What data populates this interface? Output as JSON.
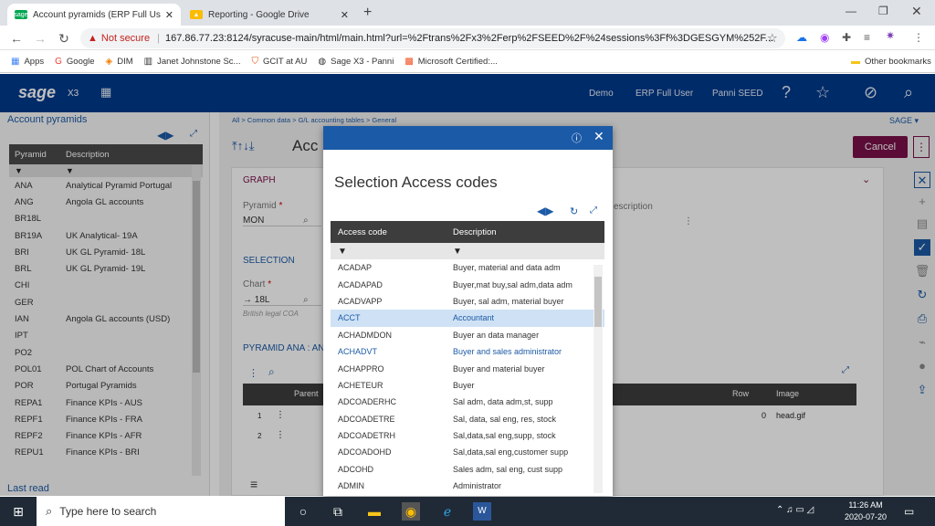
{
  "browser": {
    "tabs": [
      {
        "label": "Account pyramids (ERP Full User",
        "favicon": "sage"
      },
      {
        "label": "Reporting - Google Drive",
        "favicon": "drive"
      }
    ],
    "security": "Not secure",
    "url": "167.86.77.23:8124/syracuse-main/html/main.html?url=%2Ftrans%2Fx3%2Ferp%2FSEED%2F%24sessions%3Ff%3DGESGYM%252F...",
    "bookmarks": [
      "Apps",
      "Google",
      "DIM",
      "Janet Johnstone Sc...",
      "GCIT at AU",
      "Sage X3 - Panni",
      "Microsoft Certified:..."
    ],
    "other_bookmarks": "Other bookmarks"
  },
  "sage": {
    "logo": "sage",
    "product": "X3",
    "links": [
      "Demo",
      "ERP Full User",
      "Panni SEED"
    ]
  },
  "left": {
    "title": "Account pyramids",
    "columns": [
      "Pyramid",
      "Description"
    ],
    "filter": "T",
    "rows": [
      [
        "ANA",
        "Analytical Pyramid Portugal"
      ],
      [
        "ANG",
        "Angola GL accounts"
      ],
      [
        "BR18L",
        ""
      ],
      [
        "BR19A",
        "UK Analytical- 19A"
      ],
      [
        "BRI",
        "UK GL Pyramid- 18L"
      ],
      [
        "BRL",
        "UK GL Pyramid- 19L"
      ],
      [
        "CHI",
        ""
      ],
      [
        "GER",
        ""
      ],
      [
        "IAN",
        "Angola GL accounts (USD)"
      ],
      [
        "IPT",
        ""
      ],
      [
        "PO2",
        ""
      ],
      [
        "POL01",
        "POL Chart of Accounts"
      ],
      [
        "POR",
        "Portugal Pyramids"
      ],
      [
        "REPA1",
        "Finance KPIs - AUS"
      ],
      [
        "REPF1",
        "Finance KPIs - FRA"
      ],
      [
        "REPF2",
        "Finance KPIs - AFR"
      ],
      [
        "REPU1",
        "Finance KPIs - BRI"
      ]
    ],
    "footer": "Last read"
  },
  "main": {
    "breadcrumb": [
      "All",
      "Common data",
      "G/L accounting tables",
      "General"
    ],
    "site": "SAGE",
    "title": "Acc",
    "cancel": "Cancel",
    "section_graph": "GRAPH",
    "pyramid_label": "Pyramid",
    "pyramid_value": "MON",
    "description_label": "escription",
    "section_selection": "SELECTION",
    "chart_label": "Chart",
    "chart_value": "→ 18L",
    "chart_desc": "British legal COA",
    "section_pyramid": "PYRAMID ANA : AN",
    "grid_cols": [
      "Parent",
      "Row",
      "Image"
    ],
    "grid_rows": [
      {
        "num": "1",
        "row": "0",
        "image": "head.gif"
      },
      {
        "num": "2",
        "row": "",
        "image": ""
      }
    ]
  },
  "modal": {
    "title": "Selection Access codes",
    "columns": [
      "Access code",
      "Description"
    ],
    "rows": [
      [
        "ACADAP",
        "Buyer, material and data adm",
        ""
      ],
      [
        "ACADAPAD",
        "Buyer,mat buy,sal adm,data adm",
        ""
      ],
      [
        "ACADVAPP",
        "Buyer, sal adm, material buyer",
        ""
      ],
      [
        "ACCT",
        "Accountant",
        "sel"
      ],
      [
        "ACHADMDON",
        "Buyer an data manager",
        ""
      ],
      [
        "ACHADVT",
        "Buyer and sales administrator",
        "hl"
      ],
      [
        "ACHAPPRO",
        "Buyer and material buyer",
        ""
      ],
      [
        "ACHETEUR",
        "Buyer",
        ""
      ],
      [
        "ADCOADERHC",
        "Sal adm, data adm,st, supp",
        ""
      ],
      [
        "ADCOADETRE",
        "Sal, data, sal eng, res, stock",
        ""
      ],
      [
        "ADCOADETRH",
        "Sal,data,sal eng,supp, stock",
        ""
      ],
      [
        "ADCOADOHD",
        "Sal,data,sal eng,customer supp",
        ""
      ],
      [
        "ADCOHD",
        "Sales adm, sal eng, cust supp",
        ""
      ],
      [
        "ADMIN",
        "Administrator",
        ""
      ]
    ]
  },
  "taskbar": {
    "search_placeholder": "Type here to search",
    "time": "11:26 AM",
    "date": "2020-07-20"
  }
}
